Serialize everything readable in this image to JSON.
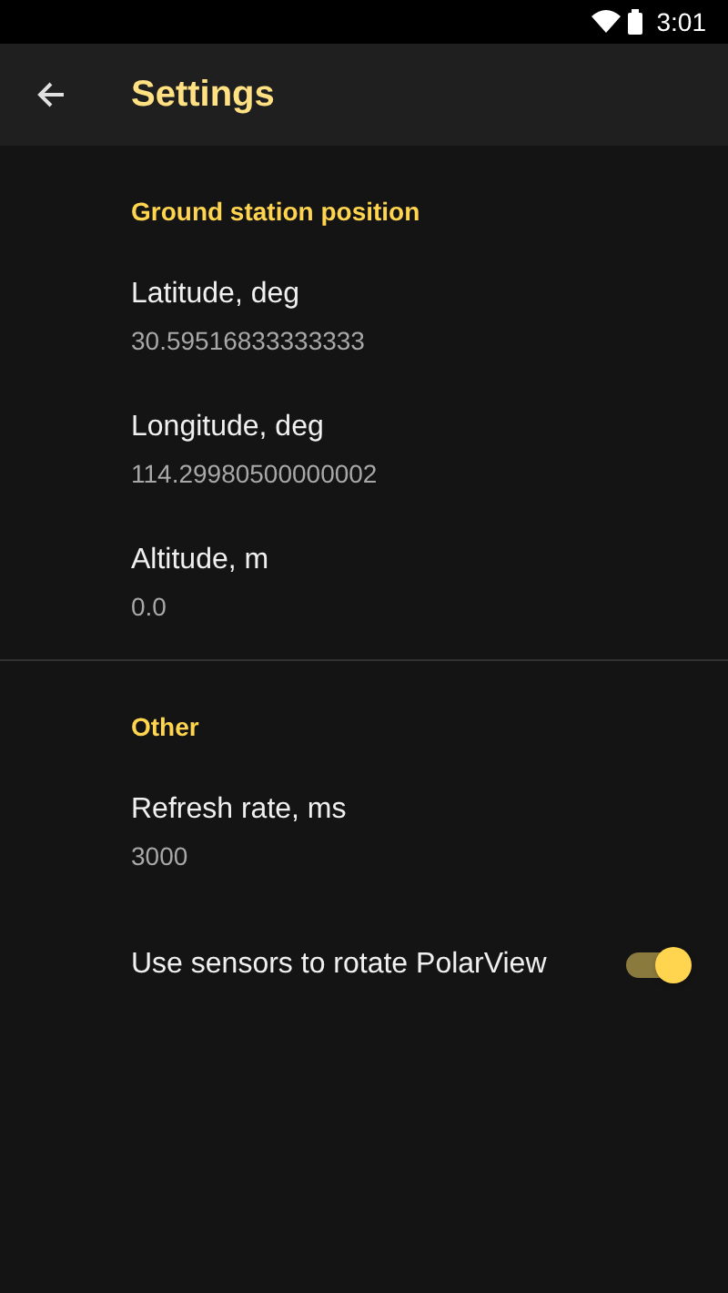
{
  "status_bar": {
    "time": "3:01"
  },
  "app_bar": {
    "title": "Settings"
  },
  "sections": [
    {
      "header": "Ground station position",
      "items": [
        {
          "kind": "text",
          "title": "Latitude, deg",
          "summary": "30.59516833333333"
        },
        {
          "kind": "text",
          "title": "Longitude, deg",
          "summary": "114.29980500000002"
        },
        {
          "kind": "text",
          "title": "Altitude, m",
          "summary": "0.0"
        }
      ]
    },
    {
      "header": "Other",
      "items": [
        {
          "kind": "text",
          "title": "Refresh rate, ms",
          "summary": "3000"
        },
        {
          "kind": "switch",
          "title": "Use sensors to rotate PolarView",
          "on": true
        }
      ]
    }
  ]
}
